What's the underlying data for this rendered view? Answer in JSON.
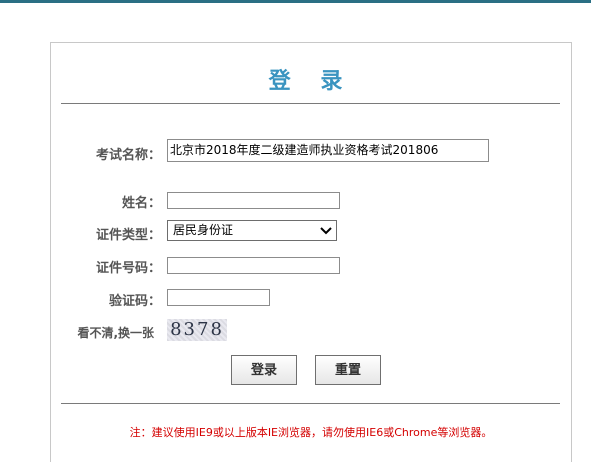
{
  "page": {
    "title": "登 录"
  },
  "form": {
    "exam_label": "考试名称：",
    "exam_value": "北京市2018年度二级建造师执业资格考试201806",
    "name_label": "姓名：",
    "name_value": "",
    "id_type_label": "证件类型：",
    "id_type_value": "居民身份证",
    "id_number_label": "证件号码：",
    "id_number_value": "",
    "captcha_label": "验证码：",
    "captcha_value": "",
    "refresh_label": "看不清,换一张",
    "captcha_image_text": "8378"
  },
  "buttons": {
    "login": "登录",
    "reset": "重置"
  },
  "notice": "注：建议使用IE9或以上版本IE浏览器，请勿使用IE6或Chrome等浏览器。"
}
